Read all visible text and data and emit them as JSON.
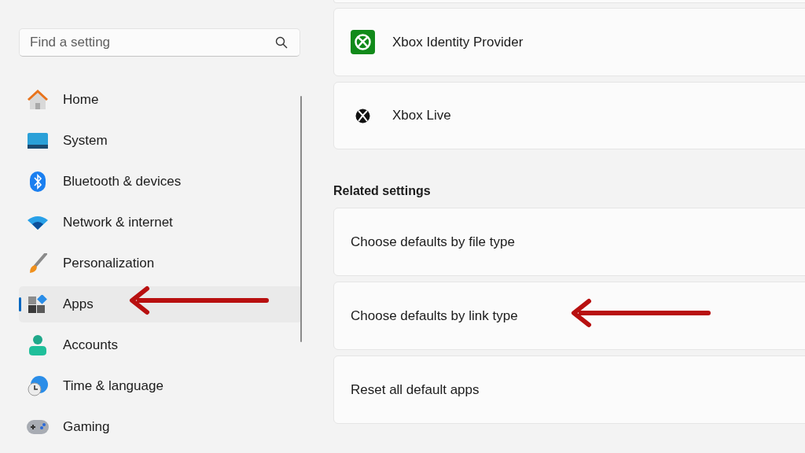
{
  "search": {
    "placeholder": "Find a setting"
  },
  "nav": [
    {
      "label": "Home",
      "selected": false
    },
    {
      "label": "System",
      "selected": false
    },
    {
      "label": "Bluetooth & devices",
      "selected": false
    },
    {
      "label": "Network & internet",
      "selected": false
    },
    {
      "label": "Personalization",
      "selected": false
    },
    {
      "label": "Apps",
      "selected": true
    },
    {
      "label": "Accounts",
      "selected": false
    },
    {
      "label": "Time & language",
      "selected": false
    },
    {
      "label": "Gaming",
      "selected": false
    }
  ],
  "apps": [
    {
      "label": "Xbox Identity Provider"
    },
    {
      "label": "Xbox Live"
    }
  ],
  "related": {
    "heading": "Related settings",
    "items": [
      {
        "label": "Choose defaults by file type"
      },
      {
        "label": "Choose defaults by link type"
      },
      {
        "label": "Reset all default apps"
      }
    ]
  }
}
